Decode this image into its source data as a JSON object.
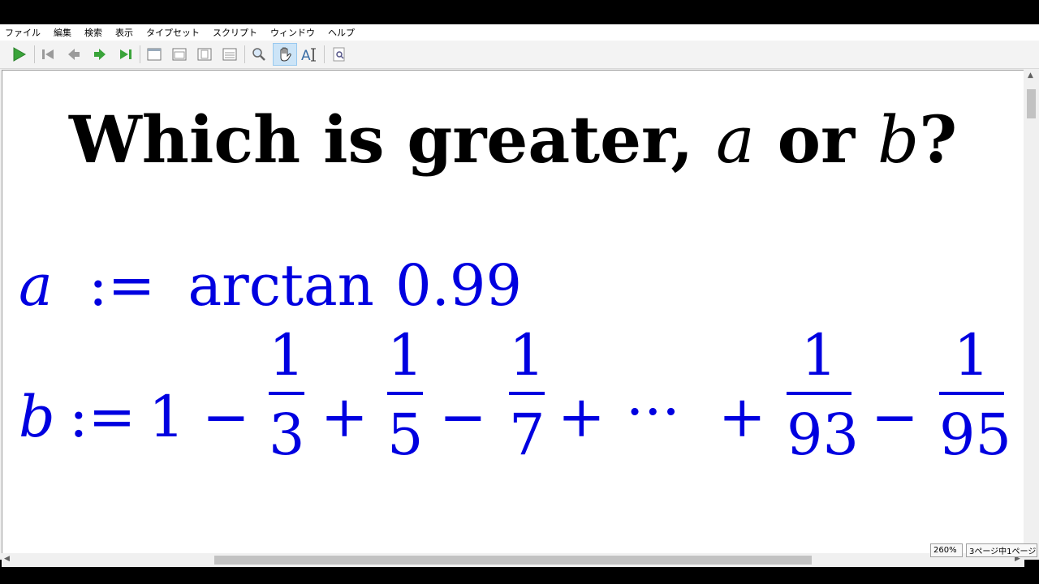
{
  "menu": [
    "ファイル",
    "編集",
    "検索",
    "表示",
    "タイプセット",
    "スクリプト",
    "ウィンドウ",
    "ヘルプ"
  ],
  "toolbar": {
    "icons": [
      "typeset-play-icon",
      "first-page-icon",
      "prev-page-icon",
      "next-page-icon",
      "last-page-icon",
      "single-page-icon",
      "two-page-icon",
      "fit-page-icon",
      "fit-width-icon",
      "magnify-icon",
      "hand-tool-icon",
      "text-select-icon",
      "find-icon"
    ]
  },
  "document": {
    "title_text": "Which is greater, ",
    "title_a": "a",
    "title_or": " or ",
    "title_b": "b",
    "title_q": "?",
    "line_a": {
      "var": "a",
      "def": ":=",
      "fn": "arctan",
      "val": "0.99"
    },
    "line_b": {
      "var": "b",
      "def": ":=",
      "one": "1",
      "terms": [
        {
          "op": "−",
          "num": "1",
          "den": "3"
        },
        {
          "op": "+",
          "num": "1",
          "den": "5"
        },
        {
          "op": "−",
          "num": "1",
          "den": "7"
        },
        {
          "op": "+",
          "dots": "···"
        },
        {
          "op": "+",
          "num": "1",
          "den": "93"
        },
        {
          "op": "−",
          "num": "1",
          "den": "95"
        }
      ]
    }
  },
  "status": {
    "zoom": "260%",
    "page": "3ページ中1ページ"
  },
  "colors": {
    "math": "#0000e0",
    "title": "#000000"
  }
}
